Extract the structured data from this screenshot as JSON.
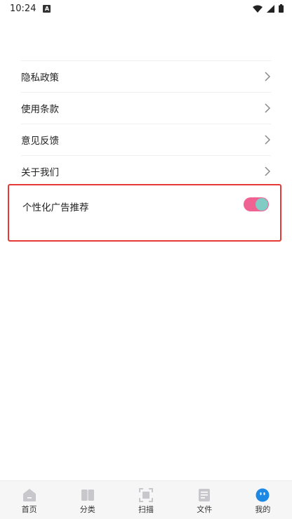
{
  "status_bar": {
    "time": "10:24",
    "badge": "A",
    "icons": [
      "wifi-icon",
      "signal-icon",
      "battery-icon"
    ]
  },
  "menu": {
    "items": [
      {
        "label": "隐私政策",
        "icon": "chevron-right-icon"
      },
      {
        "label": "使用条款",
        "icon": "chevron-right-icon"
      },
      {
        "label": "意见反馈",
        "icon": "chevron-right-icon"
      },
      {
        "label": "关于我们",
        "icon": "chevron-right-icon"
      }
    ],
    "toggle": {
      "label": "个性化广告推荐",
      "on": true
    }
  },
  "tabs": [
    {
      "label": "首页",
      "icon": "home-icon",
      "active": false
    },
    {
      "label": "分类",
      "icon": "book-icon",
      "active": false
    },
    {
      "label": "扫描",
      "icon": "scan-icon",
      "active": false
    },
    {
      "label": "文件",
      "icon": "document-icon",
      "active": false
    },
    {
      "label": "我的",
      "icon": "profile-face-icon",
      "active": true
    }
  ],
  "colors": {
    "toggle_track": "#f06292",
    "toggle_knob": "#80cbc4",
    "highlight_border": "#e53935",
    "active_tab": "#1e88e5",
    "inactive_icon": "#c7c7cc"
  }
}
